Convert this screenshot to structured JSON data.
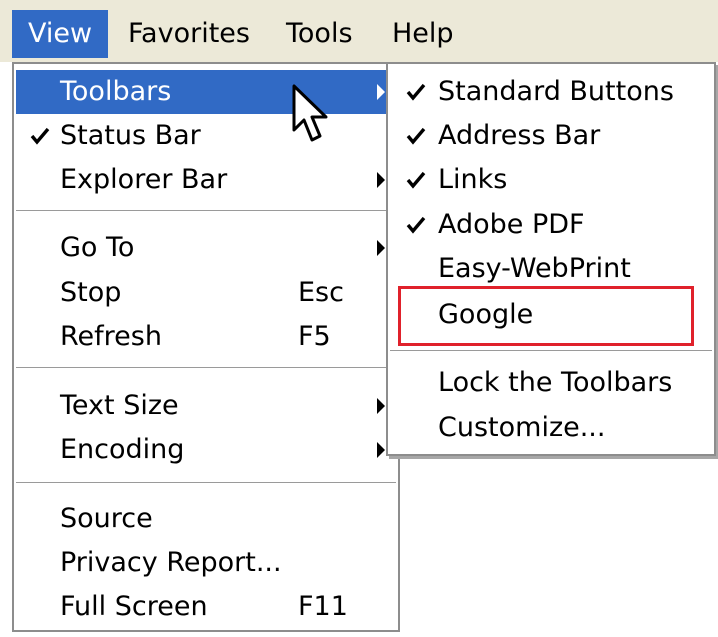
{
  "menubar": {
    "items": [
      {
        "label": "View",
        "active": true
      },
      {
        "label": "Favorites"
      },
      {
        "label": "Tools"
      },
      {
        "label": "Help"
      }
    ]
  },
  "view_menu": {
    "items": [
      {
        "label": "Toolbars",
        "checked": false,
        "submenu": true,
        "highlighted": true
      },
      {
        "label": "Status Bar",
        "checked": true
      },
      {
        "label": "Explorer Bar",
        "submenu": true
      },
      {
        "label": "Go To",
        "submenu": true
      },
      {
        "label": "Stop",
        "shortcut": "Esc"
      },
      {
        "label": "Refresh",
        "shortcut": "F5"
      },
      {
        "label": "Text Size",
        "submenu": true
      },
      {
        "label": "Encoding",
        "submenu": true
      },
      {
        "label": "Source"
      },
      {
        "label": "Privacy Report..."
      },
      {
        "label": "Full Screen",
        "shortcut": "F11"
      }
    ]
  },
  "toolbars_submenu": {
    "items": [
      {
        "label": "Standard Buttons",
        "checked": true
      },
      {
        "label": "Address Bar",
        "checked": true
      },
      {
        "label": "Links",
        "checked": true
      },
      {
        "label": "Adobe PDF",
        "checked": true
      },
      {
        "label": "Easy-WebPrint",
        "checked": false
      },
      {
        "label": "Google",
        "checked": false,
        "outlined": true
      },
      {
        "label": "Lock the Toolbars",
        "checked": false
      },
      {
        "label": "Customize...",
        "checked": false
      }
    ]
  },
  "icons": {
    "check": "checkmark-icon",
    "arrow": "submenu-arrow-icon",
    "cursor": "mouse-pointer-icon"
  },
  "colors": {
    "highlight": "#316ac5",
    "menubar_bg": "#ece9d8",
    "outline": "#e0212b"
  }
}
